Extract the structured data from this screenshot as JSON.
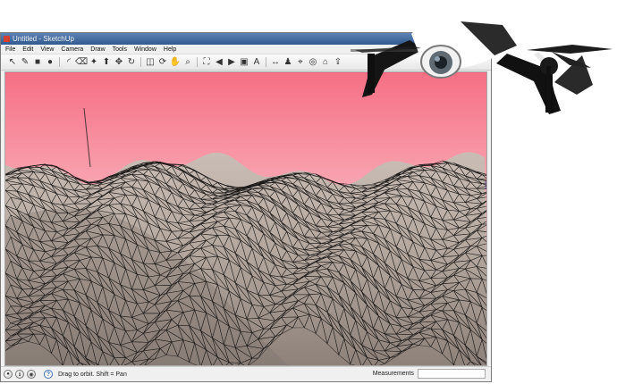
{
  "window": {
    "title": "Untitled - SketchUp"
  },
  "menu": {
    "items": [
      "File",
      "Edit",
      "View",
      "Camera",
      "Draw",
      "Tools",
      "Window",
      "Help"
    ]
  },
  "toolbar": {
    "tools": [
      {
        "name": "select-tool-icon",
        "glyph": "↖"
      },
      {
        "name": "pencil-tool-icon",
        "glyph": "✎"
      },
      {
        "name": "rectangle-tool-icon",
        "glyph": "■"
      },
      {
        "name": "circle-tool-icon",
        "glyph": "●"
      },
      {
        "name": "arc-tool-icon",
        "glyph": "◜"
      },
      {
        "name": "eraser-tool-icon",
        "glyph": "⌫"
      },
      {
        "name": "paint-bucket-icon",
        "glyph": "✦"
      },
      {
        "name": "push-pull-icon",
        "glyph": "⬆"
      },
      {
        "name": "move-tool-icon",
        "glyph": "✥"
      },
      {
        "name": "rotate-tool-icon",
        "glyph": "↻"
      },
      {
        "name": "offset-tool-icon",
        "glyph": "◫"
      },
      {
        "name": "orbit-tool-icon",
        "glyph": "⟳"
      },
      {
        "name": "pan-tool-icon",
        "glyph": "✋"
      },
      {
        "name": "zoom-tool-icon",
        "glyph": "⌕"
      },
      {
        "name": "zoom-extents-icon",
        "glyph": "⛶"
      },
      {
        "name": "previous-view-icon",
        "glyph": "◀"
      },
      {
        "name": "next-view-icon",
        "glyph": "▶"
      },
      {
        "name": "component-icon",
        "glyph": "▣"
      },
      {
        "name": "text-tool-icon",
        "glyph": "A"
      },
      {
        "name": "dimension-tool-icon",
        "glyph": "↔"
      },
      {
        "name": "walk-tool-icon",
        "glyph": "♟"
      },
      {
        "name": "position-camera-icon",
        "glyph": "⌖"
      },
      {
        "name": "look-around-icon",
        "glyph": "◎"
      },
      {
        "name": "warehouse-icon",
        "glyph": "⌂"
      },
      {
        "name": "share-model-icon",
        "glyph": "⇪"
      }
    ]
  },
  "statusbar": {
    "hint": "Drag to orbit.  Shift = Pan",
    "measurements_label": "Measurements"
  },
  "colors": {
    "sky_top": "#f56f84",
    "sky_bottom": "#fffafa",
    "terrain_fill": "#b4a89f",
    "terrain_shadow": "#7d726c",
    "mesh_line": "#1c1a19",
    "drone_body": "#ffffff",
    "drone_dark": "#1d1d1d"
  }
}
